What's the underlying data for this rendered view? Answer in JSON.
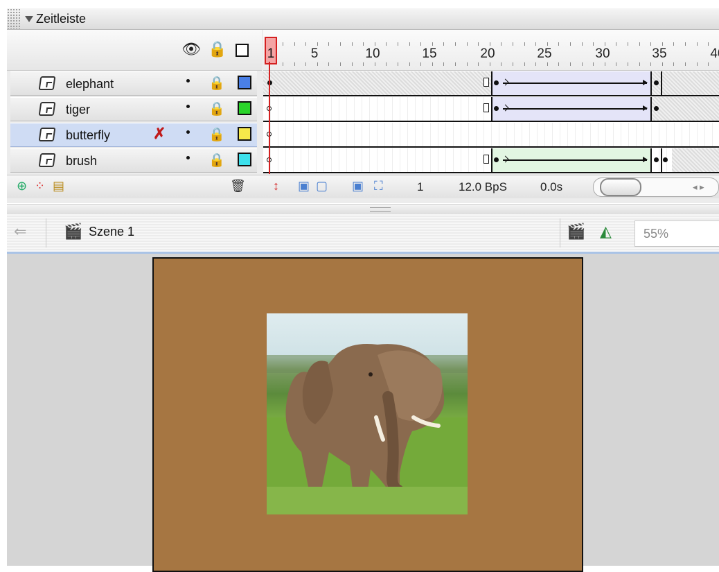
{
  "panel": {
    "title": "Zeitleiste"
  },
  "header_icons": {
    "eye": "eye-icon",
    "lock": "lock-icon",
    "outline": "outline-square-icon"
  },
  "ruler": {
    "labels": [
      "1",
      "5",
      "10",
      "15",
      "20",
      "25",
      "30",
      "35",
      "40"
    ],
    "current_frame": "1"
  },
  "layers": [
    {
      "name": "elephant",
      "color": "#4a7fe6"
    },
    {
      "name": "tiger",
      "color": "#2ad42a"
    },
    {
      "name": "butterfly",
      "color": "#f6e84a",
      "selected": true,
      "pencil": "✗"
    },
    {
      "name": "brush",
      "color": "#3de0ec"
    }
  ],
  "footer": {
    "frame": "1",
    "rate": "12.0 BpS",
    "time": "0.0s"
  },
  "edit_bar": {
    "scene": "Szene 1",
    "zoom": "55%"
  },
  "colors": {
    "stage": "#a67642",
    "playhead": "#d42020",
    "tween_motion": "#e4e4f8",
    "tween_shape": "#e2f6e2"
  }
}
